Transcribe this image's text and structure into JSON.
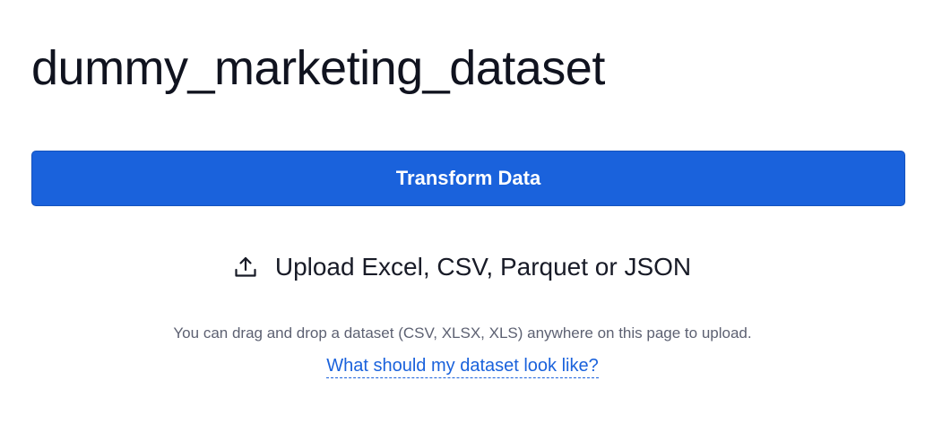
{
  "page": {
    "title": "dummy_marketing_dataset"
  },
  "actions": {
    "transform_label": "Transform Data",
    "upload_label": "Upload Excel, CSV, Parquet or JSON",
    "upload_icon": "upload-icon"
  },
  "help": {
    "hint_text": "You can drag and drop a dataset (CSV, XLSX, XLS) anywhere on this page to upload.",
    "link_text": "What should my dataset look like?"
  },
  "colors": {
    "accent": "#1a62dc",
    "title_text": "#10131f",
    "hint_text": "#5d6172"
  }
}
